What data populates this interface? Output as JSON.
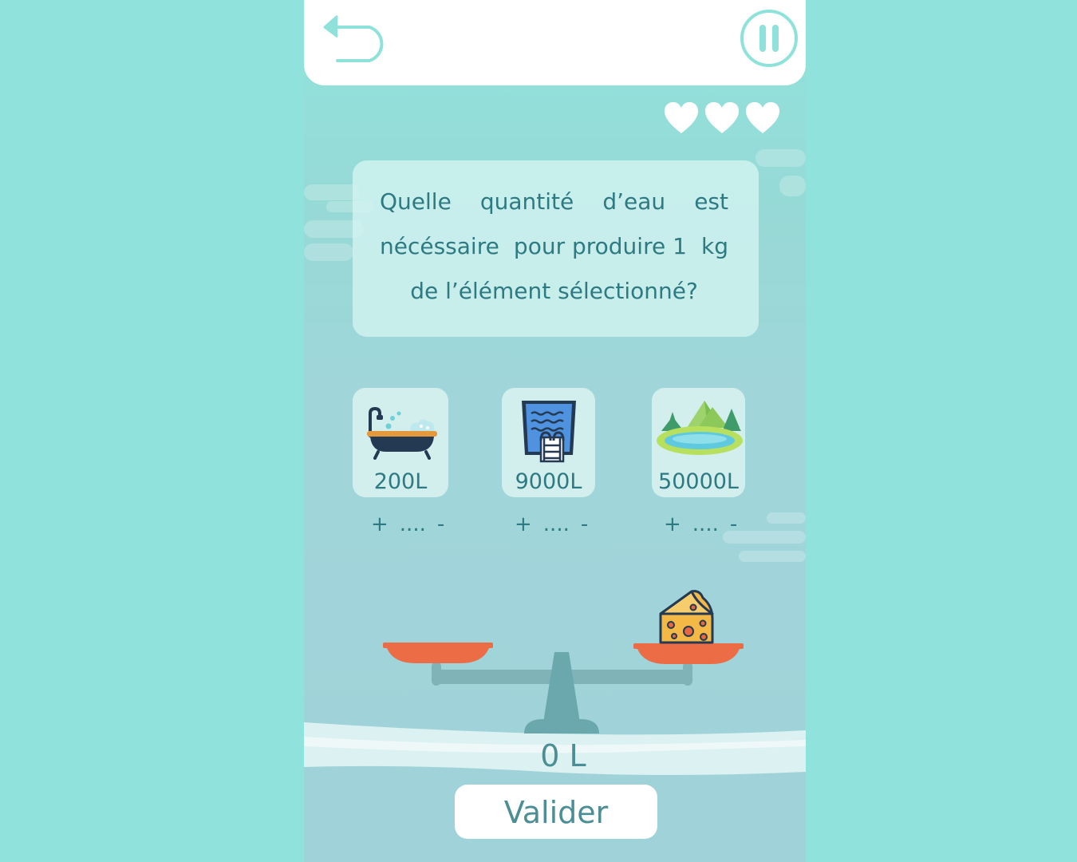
{
  "header": {
    "back_icon": "back-arrow-icon",
    "pause_icon": "pause-icon",
    "accent_color": "#8fe2da"
  },
  "lives": {
    "count": 3,
    "icon": "heart-icon",
    "color": "#ffffff"
  },
  "question": {
    "lines": [
      [
        "Quelle",
        "quantité",
        "d’eau",
        "est"
      ],
      [
        "nécéssaire",
        "pour produire 1",
        "kg"
      ],
      [
        "de l’élément sélectionné?"
      ]
    ]
  },
  "options": [
    {
      "icon": "bathtub-icon",
      "value": "200L",
      "stepper": {
        "plus": "+",
        "count": "....",
        "minus": "-"
      }
    },
    {
      "icon": "swimming-pool-icon",
      "value": "9000L",
      "stepper": {
        "plus": "+",
        "count": "....",
        "minus": "-"
      }
    },
    {
      "icon": "lake-icon",
      "value": "50000L",
      "stepper": {
        "plus": "+",
        "count": "....",
        "minus": "-"
      }
    }
  ],
  "scale": {
    "icon": "balance-scale-icon",
    "item_icon": "cheese-icon",
    "pan_color": "#ec6d45"
  },
  "total": "0 L",
  "validate_label": "Valider"
}
